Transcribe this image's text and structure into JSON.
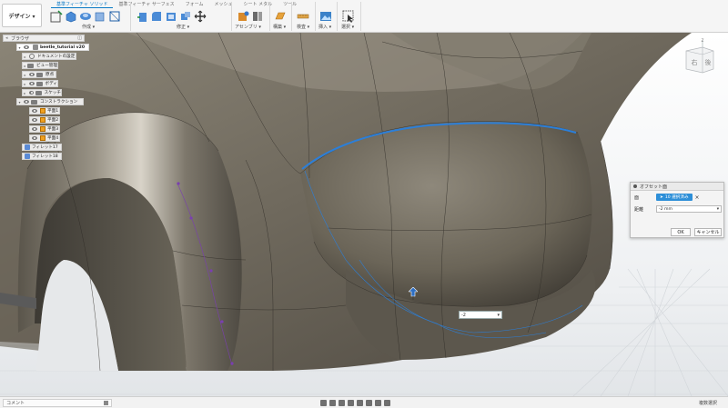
{
  "workspace": {
    "label": "デザイン ▾"
  },
  "toolbar": {
    "tabs_left": [
      "基準フィーチャ ソリッド",
      "基準フィーチャ サーフェス",
      "フォーム",
      "メッシュ",
      "シート メタル",
      "ツール"
    ],
    "active_tab_index": 0,
    "groups": [
      {
        "label": "作成 ▾"
      },
      {
        "label": "修正 ▾"
      },
      {
        "label": "アセンブリ ▾"
      },
      {
        "label": "構築 ▾"
      },
      {
        "label": "検査 ▾"
      },
      {
        "label": "挿入 ▾"
      },
      {
        "label": "選択 ▾"
      }
    ]
  },
  "browser": {
    "title": "ブラウザ",
    "items": [
      {
        "label": "beetle_tutorial v20",
        "kind": "root"
      },
      {
        "label": "ドキュメントの設定",
        "kind": "settings"
      },
      {
        "label": "ビュー管理",
        "kind": "folder"
      },
      {
        "label": "原点",
        "kind": "folder"
      },
      {
        "label": "ボディ",
        "kind": "folder"
      },
      {
        "label": "スケッチ",
        "kind": "folder"
      },
      {
        "label": "コンストラクション",
        "kind": "folder"
      },
      {
        "label": "平面1",
        "kind": "plane"
      },
      {
        "label": "平面2",
        "kind": "plane"
      },
      {
        "label": "平面3",
        "kind": "plane"
      },
      {
        "label": "平面4",
        "kind": "plane"
      },
      {
        "label": "フィレット17",
        "kind": "body"
      },
      {
        "label": "フィレット18",
        "kind": "body"
      }
    ]
  },
  "viewcube": {
    "face_right": "右",
    "face_back": "後",
    "axis_label": "Z"
  },
  "offset_dialog": {
    "title": "オフセット面",
    "face_label": "面",
    "face_selection": "10 選択済み",
    "distance_label": "距離",
    "distance_value": "-2 mm",
    "ok_label": "OK",
    "cancel_label": "キャンセル"
  },
  "canvas_input": {
    "value": "-2"
  },
  "bottombar": {
    "comment_label": "コメント",
    "status_text": "複数選択"
  },
  "colors": {
    "accent": "#2d8fd8",
    "body_surface": "#7c7466",
    "grid": "#d9dde2"
  }
}
